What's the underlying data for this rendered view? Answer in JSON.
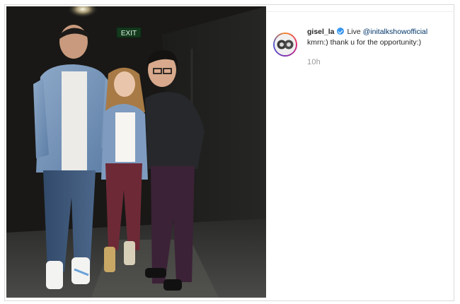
{
  "post": {
    "username": "gisel_la",
    "caption_prefix": "Live ",
    "mention": "@initalkshowofficial",
    "caption_suffix": "kmrn:) thank u for the opportunity:)",
    "timestamp": "10h"
  },
  "photo": {
    "exit_sign": "EXIT"
  },
  "colors": {
    "verified": "#3897f0",
    "mention": "#003569",
    "muted": "#999999"
  }
}
